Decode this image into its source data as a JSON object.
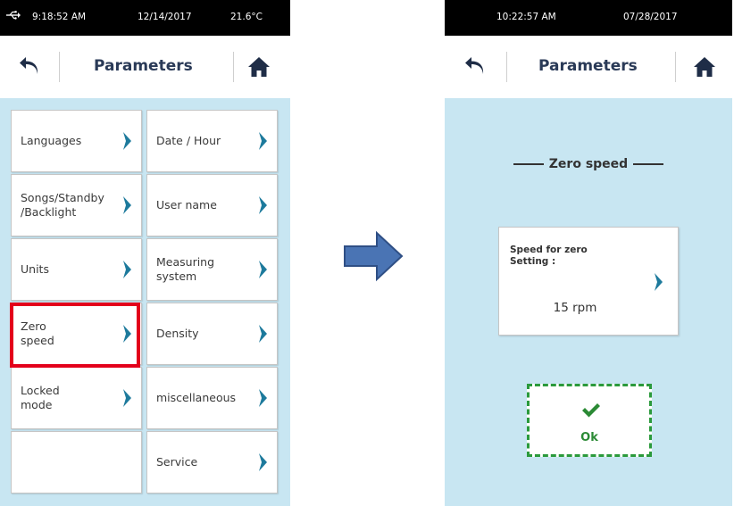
{
  "left_screen": {
    "status": {
      "time": "9:18:52 AM",
      "date": "12/14/2017",
      "temperature": "21.6°C",
      "usb_icon": "usb-icon"
    },
    "header": {
      "title": "Parameters",
      "back_icon": "back-arrow-icon",
      "home_icon": "home-icon"
    },
    "tiles": [
      {
        "label": "Languages"
      },
      {
        "label": "Date / Hour"
      },
      {
        "label": "Songs/Standby\n/Backlight"
      },
      {
        "label": "User name"
      },
      {
        "label": "Units"
      },
      {
        "label": "Measuring\nsystem"
      },
      {
        "label": "Zero\nspeed",
        "highlighted": true
      },
      {
        "label": "Density"
      },
      {
        "label": "Locked\nmode"
      },
      {
        "label": "miscellaneous"
      },
      {
        "label": ""
      },
      {
        "label": "Service"
      }
    ]
  },
  "right_screen": {
    "status": {
      "time": "10:22:57 AM",
      "date": "07/28/2017"
    },
    "header": {
      "title": "Parameters",
      "back_icon": "back-arrow-icon",
      "home_icon": "home-icon"
    },
    "section_title": "Zero speed",
    "speed_card": {
      "label": "Speed for zero\nSetting :",
      "value": "15 rpm"
    },
    "ok_button": {
      "label": "Ok",
      "icon": "checkmark-icon"
    }
  },
  "colors": {
    "accent_teal": "#1d7a9c",
    "title_navy": "#2a3a57",
    "content_bg": "#c8e6f2",
    "highlight_red": "#e3001b",
    "ok_green": "#2b9a3c",
    "arrow_blue": "#4a74b4"
  }
}
